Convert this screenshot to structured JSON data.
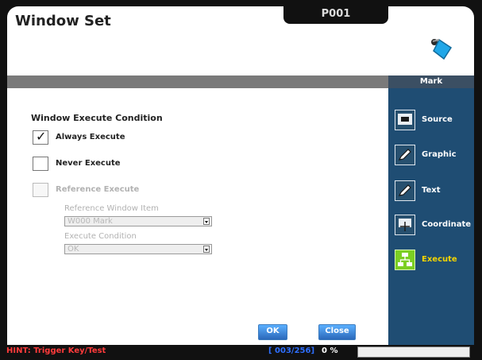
{
  "window": {
    "title": "Window Set",
    "program_id": "P001"
  },
  "topbar": {
    "mark_tab": "Mark"
  },
  "sidebar": {
    "items": [
      {
        "label": "Source",
        "icon": "monitor-icon"
      },
      {
        "label": "Graphic",
        "icon": "pencil-icon"
      },
      {
        "label": "Text",
        "icon": "pencil-icon"
      },
      {
        "label": "Coordinate",
        "icon": "move-icon"
      },
      {
        "label": "Execute",
        "icon": "flowchart-icon",
        "active": true
      }
    ]
  },
  "main": {
    "heading": "Window Execute Condition",
    "options": [
      {
        "label": "Always Execute",
        "checked": true
      },
      {
        "label": "Never Execute",
        "checked": false
      },
      {
        "label": "Reference Execute",
        "checked": false,
        "enabled": false
      }
    ],
    "reference": {
      "window_item_label": "Reference Window Item",
      "window_item_value": "W000 Mark",
      "condition_label": "Execute Condition",
      "condition_value": "OK"
    },
    "buttons": {
      "ok": "OK",
      "close": "Close"
    }
  },
  "statusbar": {
    "hint": "HINT: Trigger Key/Test",
    "counter": "[ 003/256]",
    "percent": "0 %",
    "progress_fraction": 0
  },
  "colors": {
    "sidebar_bg": "#1f4d73",
    "active_icon": "#7ccf23",
    "active_text": "#f2d300",
    "hint_text": "#ff3b3b",
    "counter_text": "#2e6fff"
  }
}
